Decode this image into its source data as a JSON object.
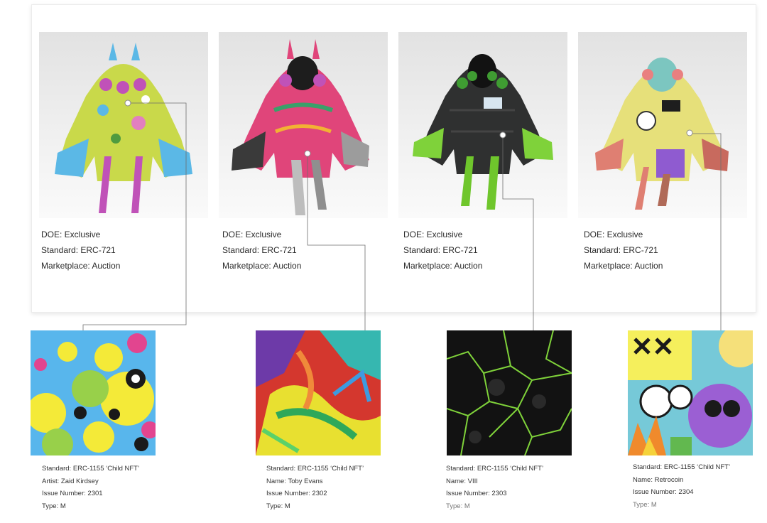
{
  "parents": [
    {
      "doe": "DOE: Exclusive",
      "standard": "Standard: ERC-721",
      "marketplace": "Marketplace: Auction",
      "palette": {
        "body": "#c9d94a",
        "accent": "#5bb8e6",
        "trim": "#c052b8"
      }
    },
    {
      "doe": "DOE: Exclusive",
      "standard": "Standard: ERC-721",
      "marketplace": "Marketplace: Auction",
      "palette": {
        "body": "#e0457a",
        "accent": "#3aa06a",
        "trim": "#c9c9c9"
      }
    },
    {
      "doe": "DOE: Exclusive",
      "standard": "Standard: ERC-721",
      "marketplace": "Marketplace: Auction",
      "palette": {
        "body": "#2f3030",
        "accent": "#7fd23a",
        "trim": "#6fc62c"
      }
    },
    {
      "doe": "DOE: Exclusive",
      "standard": "Standard: ERC-721",
      "marketplace": "Marketplace: Auction",
      "palette": {
        "body": "#e6e07a",
        "accent": "#df7f72",
        "trim": "#8f5bd0"
      }
    }
  ],
  "children": [
    {
      "line1": "Standard: ERC-1155 ‘Child NFT’",
      "line2": "Artist: Zaid Kirdsey",
      "line3": "Issue Number: 2301",
      "line4": "Type: M"
    },
    {
      "line1": "Standard: ERC-1155 ‘Child NFT’",
      "line2": "Name: Toby Evans",
      "line3": "Issue Number: 2302",
      "line4": "Type: M"
    },
    {
      "line1": "Standard: ERC-1155 ‘Child NFT’",
      "line2": "Name: VIII",
      "line3": "Issue Number: 2303",
      "line4": "Type: M"
    },
    {
      "line1": "Standard: ERC-1155 ‘Child NFT’",
      "line2": "Name: Retrocoin",
      "line3": "Issue Number: 2304",
      "line4": "Type: M"
    }
  ],
  "colors": {
    "connector": "#6e6e6e",
    "panel_border": "#ececec"
  }
}
